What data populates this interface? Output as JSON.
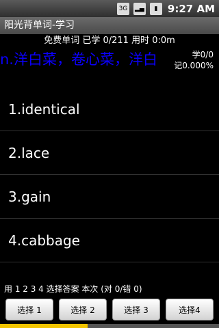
{
  "status_bar": {
    "network_label": "3G",
    "clock": "9:27 AM"
  },
  "app": {
    "title": "阳光背单词-学习"
  },
  "study": {
    "stats_line": "免费单词 已学 0/211 用时 0:0m",
    "definition": "n.洋白菜，卷心菜，洋白",
    "side_stats": {
      "learned": "学0/0",
      "memory": "记0.000%"
    },
    "options": [
      "1.identical",
      "2.lace",
      "3.gain",
      "4.cabbage"
    ],
    "hint_text": "用 1 2 3 4 选择答案 本次 (对 0/错 0)"
  },
  "buttons": [
    "选择 1",
    "选择 2",
    "选择 3",
    "选择4"
  ],
  "colors": {
    "definition_blue": "#0b00ff",
    "progress_yellow": "#f2c400"
  }
}
